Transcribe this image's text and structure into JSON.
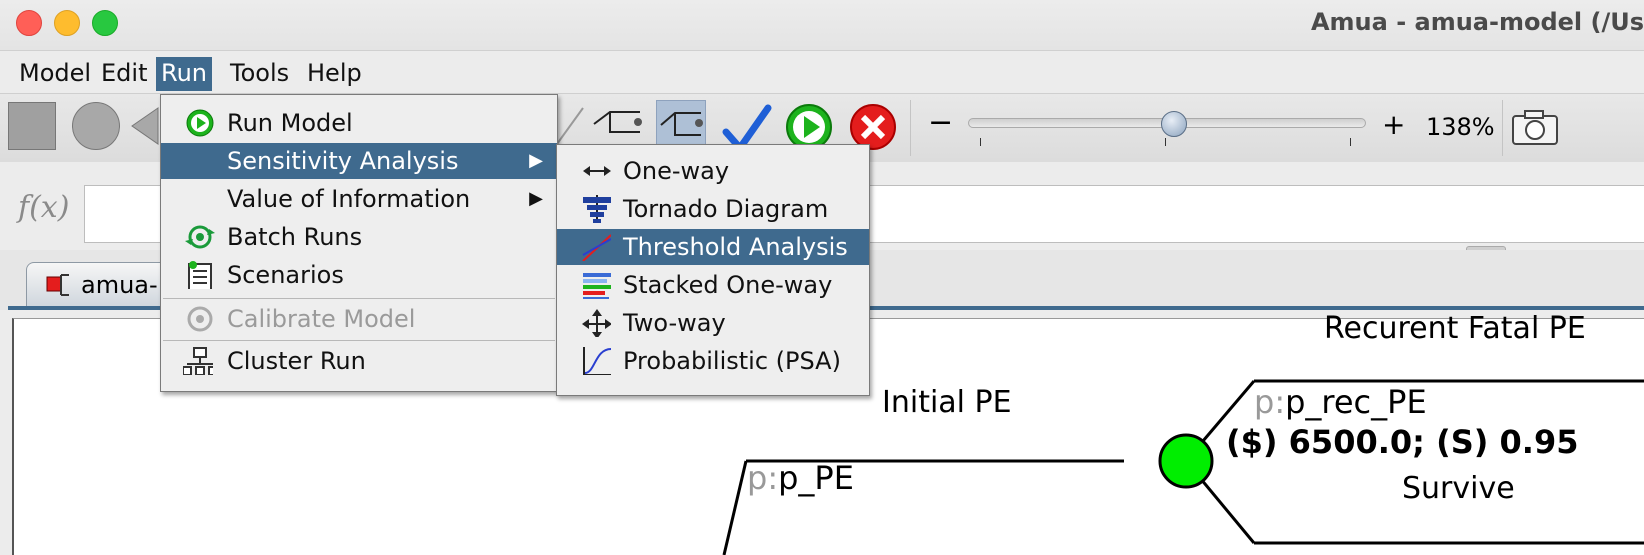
{
  "window": {
    "title": "Amua - amua-model (/Us"
  },
  "menubar": {
    "items": [
      {
        "label": "Model"
      },
      {
        "label": "Edit"
      },
      {
        "label": "Run"
      },
      {
        "label": "Tools"
      },
      {
        "label": "Help"
      }
    ]
  },
  "run_menu": {
    "items": [
      {
        "label": "Run Model",
        "icon": "play-icon"
      },
      {
        "label": "Sensitivity Analysis",
        "highlighted": true,
        "submenu": true
      },
      {
        "label": "Value of Information",
        "submenu": true
      },
      {
        "label": "Batch Runs",
        "icon": "batch-runs-icon"
      },
      {
        "label": "Scenarios",
        "icon": "scenarios-icon"
      },
      {
        "label": "Calibrate Model",
        "disabled": true,
        "icon": "calibrate-icon"
      },
      {
        "label": "Cluster Run",
        "icon": "cluster-icon"
      }
    ]
  },
  "sensitivity_submenu": {
    "items": [
      {
        "label": "One-way",
        "icon": "double-arrow-icon"
      },
      {
        "label": "Tornado Diagram",
        "icon": "tornado-icon"
      },
      {
        "label": "Threshold Analysis",
        "highlighted": true,
        "icon": "threshold-icon"
      },
      {
        "label": "Stacked One-way",
        "icon": "stacked-bars-icon"
      },
      {
        "label": "Two-way",
        "icon": "move-arrows-icon"
      },
      {
        "label": "Probabilistic (PSA)",
        "icon": "s-curve-icon"
      }
    ]
  },
  "toolbar": {
    "zoom_minus": "−",
    "zoom_plus": "+",
    "zoom_level": "138%",
    "zoom_slider_value": 0.52
  },
  "formula_bar": {
    "label": "f(x)",
    "value": ""
  },
  "tabs": [
    {
      "label": "amua-"
    }
  ],
  "canvas": {
    "nodes": [
      {
        "label": "Initial PE",
        "prob_prefix": "p:",
        "prob": "p_PE"
      },
      {
        "label": "Recurent Fatal PE",
        "prob_prefix": "p:",
        "prob": "p_rec_PE",
        "payoff": "($) 6500.0; (S) 0.95"
      },
      {
        "label": "Survive"
      }
    ]
  },
  "colors": {
    "menu_highlight": "#3f6a8e",
    "chance_node": "#00ee00"
  }
}
